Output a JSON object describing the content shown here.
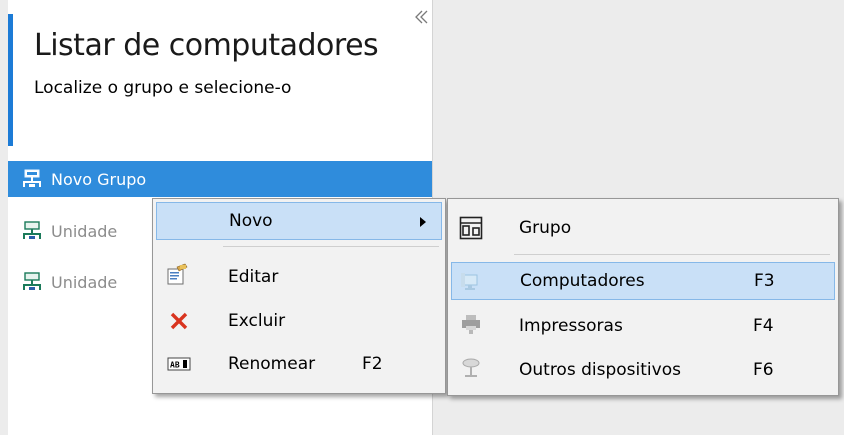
{
  "panel": {
    "title": "Listar de computadores",
    "subtitle": "Localize o grupo e selecione-o",
    "accent_color": "#1c7bd6",
    "collapse_icon": "double-chevron-left-icon"
  },
  "tree": {
    "items": [
      {
        "label": "Novo Grupo",
        "icon": "network-group-icon",
        "selected": true
      },
      {
        "label": "Unidade",
        "icon": "network-group-icon",
        "selected": false
      },
      {
        "label": "Unidade",
        "icon": "network-group-icon",
        "selected": false
      }
    ],
    "selection_color": "#2f8cdc"
  },
  "context_menu": {
    "items": [
      {
        "label": "Novo",
        "has_submenu": true,
        "icon": "",
        "shortcut": ""
      },
      {
        "label": "Editar",
        "icon": "edit-properties-icon",
        "shortcut": ""
      },
      {
        "label": "Excluir",
        "icon": "delete-x-icon",
        "shortcut": ""
      },
      {
        "label": "Renomear",
        "icon": "rename-text-icon",
        "shortcut": "F2"
      }
    ]
  },
  "submenu": {
    "items": [
      {
        "label": "Grupo",
        "icon": "group-layout-icon",
        "shortcut": ""
      },
      {
        "label": "Computadores",
        "icon": "computer-icon",
        "shortcut": "F3"
      },
      {
        "label": "Impressoras",
        "icon": "printer-icon",
        "shortcut": "F4"
      },
      {
        "label": "Outros dispositivos",
        "icon": "device-icon",
        "shortcut": "F6"
      }
    ],
    "highlight_color": "#c9e0f7"
  }
}
